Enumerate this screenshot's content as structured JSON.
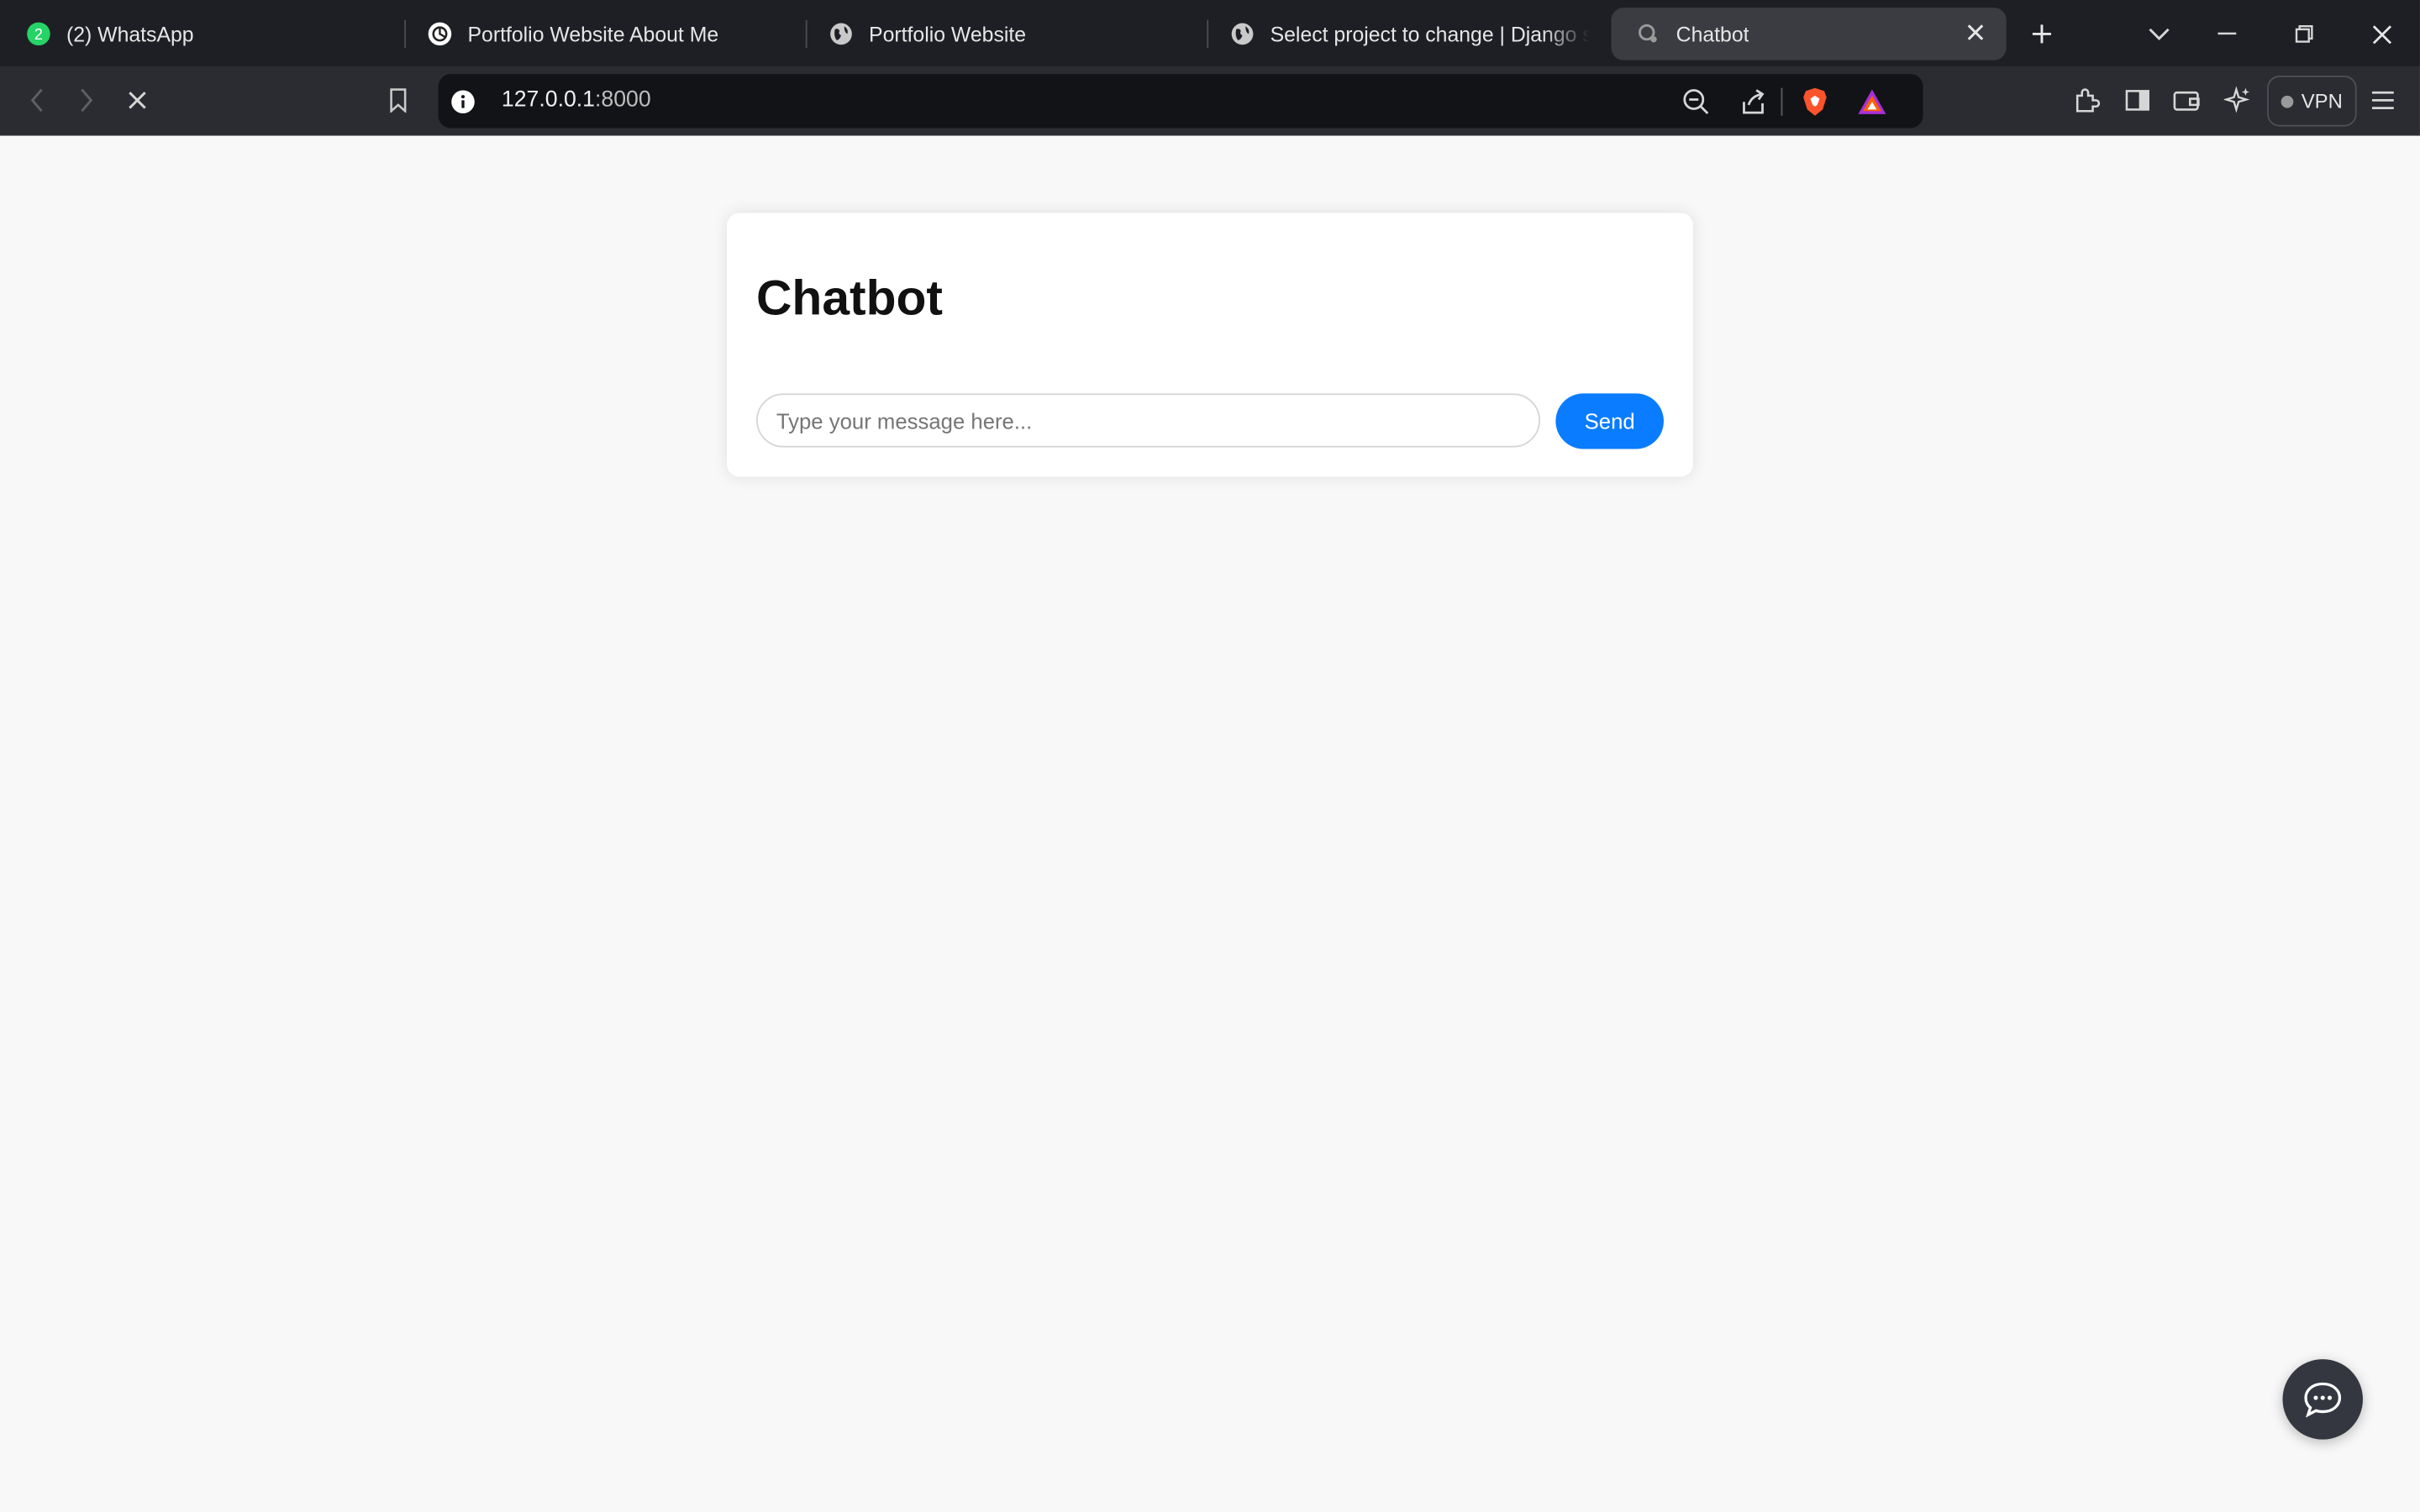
{
  "browser": {
    "tabs": [
      {
        "title": "(2) WhatsApp",
        "icon": "whatsapp-icon",
        "badge": "2"
      },
      {
        "title": "Portfolio Website About Me",
        "icon": "openai-icon"
      },
      {
        "title": "Portfolio Website",
        "icon": "globe-icon"
      },
      {
        "title": "Select project to change | Django site",
        "icon": "globe-icon"
      },
      {
        "title": "Chatbot",
        "icon": "loading-icon",
        "active": true
      }
    ],
    "address": {
      "host": "127.0.0.1",
      "port": ":8000"
    },
    "vpn_label": "VPN"
  },
  "page": {
    "title": "Chatbot",
    "input_placeholder": "Type your message here...",
    "send_label": "Send"
  },
  "colors": {
    "accent": "#0a7cff",
    "page_bg": "#f8f8f8",
    "chrome_bg": "#1d1f24"
  }
}
